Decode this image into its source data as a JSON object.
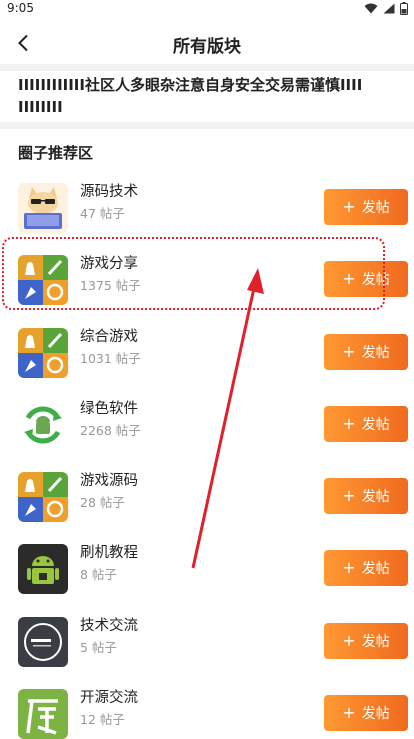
{
  "status": {
    "time": "9:05"
  },
  "header": {
    "title": "所有版块"
  },
  "notice": {
    "text": "IIIIIIIIIIII社区人多眼杂注意自身安全交易需谨慎IIIIIIIIIIII"
  },
  "section": {
    "title": "圈子推荐区"
  },
  "post_button_label": "发帖",
  "forums": [
    {
      "name": "源码技术",
      "count": "47 帖子",
      "icon": "cat-laptop-icon"
    },
    {
      "name": "游戏分享",
      "count": "1375 帖子",
      "icon": "game-tiles-icon"
    },
    {
      "name": "综合游戏",
      "count": "1031 帖子",
      "icon": "game-tiles-icon"
    },
    {
      "name": "绿色软件",
      "count": "2268 帖子",
      "icon": "android-recycle-icon"
    },
    {
      "name": "游戏源码",
      "count": "28 帖子",
      "icon": "game-tiles-icon"
    },
    {
      "name": "刷机教程",
      "count": "8 帖子",
      "icon": "android-root-icon"
    },
    {
      "name": "技术交流",
      "count": "5 帖子",
      "icon": "enter-circle-icon"
    },
    {
      "name": "开源交流",
      "count": "12 帖子",
      "icon": "yuan-character-icon"
    }
  ],
  "colors": {
    "accent_start": "#ff9933",
    "accent_end": "#f06a1e",
    "annotation": "#e0202a"
  }
}
